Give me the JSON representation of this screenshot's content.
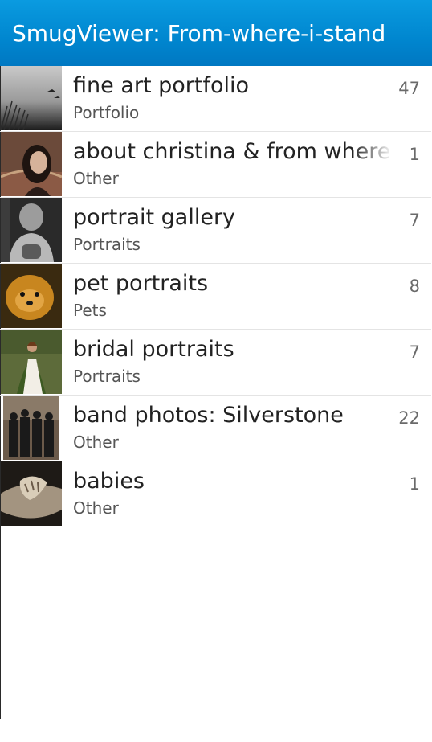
{
  "header": {
    "title": "SmugViewer: From-where-i-stand"
  },
  "albums": [
    {
      "name": "fine art portfolio",
      "category": "Portfolio",
      "count": "47"
    },
    {
      "name": "about christina & from where i stand",
      "category": "Other",
      "count": "1"
    },
    {
      "name": "portrait gallery",
      "category": "Portraits",
      "count": "7"
    },
    {
      "name": "pet portraits",
      "category": "Pets",
      "count": "8"
    },
    {
      "name": "bridal portraits",
      "category": "Portraits",
      "count": "7"
    },
    {
      "name": "band photos: Silverstone",
      "category": "Other",
      "count": "22"
    },
    {
      "name": "babies",
      "category": "Other",
      "count": "1"
    }
  ]
}
